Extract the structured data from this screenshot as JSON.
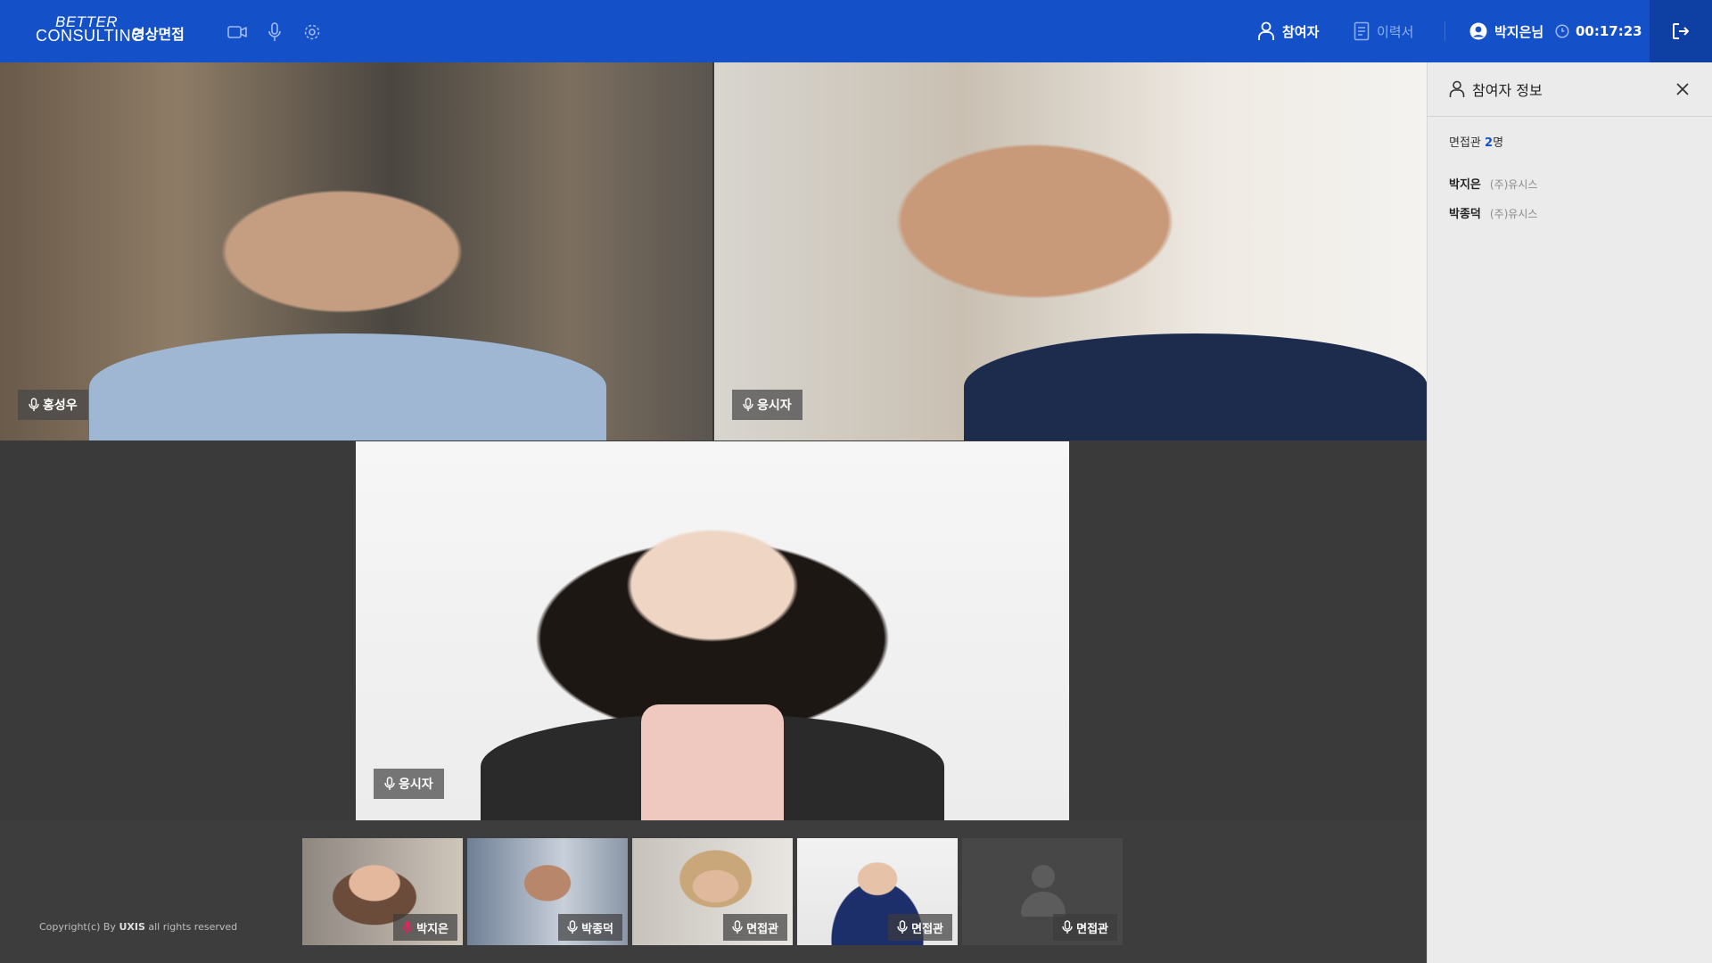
{
  "header": {
    "logo_line1": "BETTER",
    "logo_line2": "CONSULTING",
    "app_title": "영상면접",
    "tool_icons": [
      "video-camera-icon",
      "microphone-icon",
      "settings-gear-icon"
    ],
    "participants_label": "참여자",
    "resume_label": "이력서",
    "user_name": "박지은님",
    "timer": "00:17:23",
    "exit_icon": "logout-icon"
  },
  "stage": {
    "tiles": [
      {
        "name": "홍성우",
        "mic": "on"
      },
      {
        "name": "응시자",
        "mic": "on"
      },
      {
        "name": "응시자",
        "mic": "on"
      }
    ]
  },
  "strip": {
    "copyright_prefix": "Copyright(c) By ",
    "copyright_brand": "UXIS",
    "copyright_suffix": " all rights reserved",
    "thumbs": [
      {
        "label": "박지은",
        "mic": "active",
        "mic_color": "#e0245e"
      },
      {
        "label": "박종덕",
        "mic": "on"
      },
      {
        "label": "면접관",
        "mic": "on"
      },
      {
        "label": "면접관",
        "mic": "on"
      },
      {
        "label": "면접관",
        "mic": "on",
        "video": "off"
      }
    ]
  },
  "panel": {
    "title": "참여자 정보",
    "count_label": "면접관 ",
    "count_value": "2",
    "count_unit": "명",
    "participants": [
      {
        "name": "박지은",
        "company": "(주)유시스"
      },
      {
        "name": "박종덕",
        "company": "(주)유시스"
      }
    ]
  },
  "colors": {
    "header_bg": "#1450c8",
    "exit_bg": "#0e3fa3",
    "stage_bg": "#3a3a3a",
    "panel_bg": "#ebebeb",
    "accent": "#1450c8",
    "mic_active": "#e0245e"
  }
}
